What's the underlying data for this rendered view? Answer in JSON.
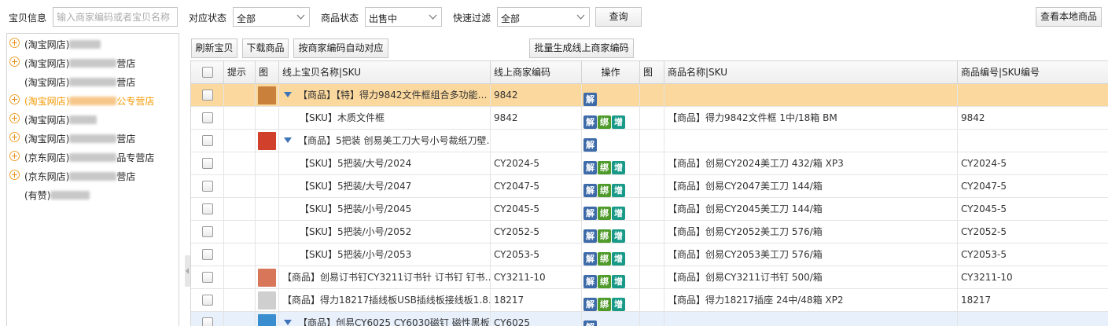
{
  "filters": {
    "item_info_label": "宝贝信息",
    "item_info_placeholder": "输入商家编码或者宝贝名称",
    "match_status_label": "对应状态",
    "match_status_value": "全部",
    "product_status_label": "商品状态",
    "product_status_value": "出售中",
    "quick_filter_label": "快速过滤",
    "quick_filter_value": "全部",
    "query_button": "查询",
    "view_local_button": "查看本地商品"
  },
  "toolbar": {
    "refresh": "刷新宝贝",
    "download": "下载商品",
    "auto_match": "按商家编码自动对应",
    "batch_generate": "批量生成线上商家编码"
  },
  "tree": [
    {
      "prefix": "(淘宝网店)",
      "suffix": "",
      "expandable": true,
      "selected": false
    },
    {
      "prefix": "(淘宝网店)",
      "suffix": "营店",
      "expandable": true,
      "selected": false
    },
    {
      "prefix": "(淘宝网店)",
      "suffix": "营店",
      "expandable": false,
      "selected": false
    },
    {
      "prefix": "(淘宝网店)",
      "suffix": "公专营店",
      "expandable": true,
      "selected": true
    },
    {
      "prefix": "(淘宝网店)",
      "suffix": "",
      "expandable": true,
      "selected": false
    },
    {
      "prefix": "(淘宝网店)",
      "suffix": "营店",
      "expandable": true,
      "selected": false
    },
    {
      "prefix": "(京东网店)",
      "suffix": "品专营店",
      "expandable": true,
      "selected": false
    },
    {
      "prefix": "(京东网店)",
      "suffix": "营店",
      "expandable": true,
      "selected": false
    },
    {
      "prefix": "(有赞)",
      "suffix": "",
      "expandable": false,
      "selected": false
    }
  ],
  "columns": {
    "hint": "提示",
    "image": "图",
    "online_name": "线上宝贝名称|SKU",
    "online_code": "线上商家编码",
    "operation": "操作",
    "image2": "图",
    "product_name": "商品名称|SKU",
    "product_code": "商品编号|SKU编号"
  },
  "ops_labels": {
    "jie": "解",
    "bang": "绑",
    "zeng": "增"
  },
  "rows": [
    {
      "type": "product",
      "name": "【商品】【特】得力9842文件框组合多功能…",
      "code": "9842",
      "ops": [
        "jie"
      ],
      "product": "",
      "pcode": "",
      "thumb": "#c9803a",
      "selected": true
    },
    {
      "type": "sku",
      "name": "【SKU】木质文件框",
      "code": "9842",
      "ops": [
        "jie",
        "bang",
        "zeng"
      ],
      "product": "【商品】得力9842文件框 1中/18箱 BM",
      "pcode": "9842"
    },
    {
      "type": "product",
      "name": "【商品】5把装 创易美工刀大号小号裁纸刀壁…",
      "code": "",
      "ops": [
        "jie"
      ],
      "product": "",
      "pcode": "",
      "thumb": "#d0402a"
    },
    {
      "type": "sku",
      "name": "【SKU】5把装/大号/2024",
      "code": "CY2024-5",
      "ops": [
        "jie",
        "bang",
        "zeng"
      ],
      "product": "【商品】创易CY2024美工刀 432/箱 XP3",
      "pcode": "CY2024-5"
    },
    {
      "type": "sku",
      "name": "【SKU】5把装/大号/2047",
      "code": "CY2047-5",
      "ops": [
        "jie",
        "bang",
        "zeng"
      ],
      "product": "【商品】创易CY2047美工刀 144/箱",
      "pcode": "CY2047-5"
    },
    {
      "type": "sku",
      "name": "【SKU】5把装/小号/2045",
      "code": "CY2045-5",
      "ops": [
        "jie",
        "bang",
        "zeng"
      ],
      "product": "【商品】创易CY2045美工刀 144/箱",
      "pcode": "CY2045-5"
    },
    {
      "type": "sku",
      "name": "【SKU】5把装/小号/2052",
      "code": "CY2052-5",
      "ops": [
        "jie",
        "bang",
        "zeng"
      ],
      "product": "【商品】创易CY2052美工刀 576/箱",
      "pcode": "CY2052-5"
    },
    {
      "type": "sku",
      "name": "【SKU】5把装/小号/2053",
      "code": "CY2053-5",
      "ops": [
        "jie",
        "bang",
        "zeng"
      ],
      "product": "【商品】创易CY2053美工刀 576/箱",
      "pcode": "CY2053-5"
    },
    {
      "type": "single",
      "name": "【商品】创易订书钉CY3211订书针 订书钉 钉书…",
      "code": "CY3211-10",
      "ops": [
        "jie",
        "bang",
        "zeng"
      ],
      "product": "【商品】创易CY3211订书钉 500/箱",
      "pcode": "CY3211-10",
      "thumb": "#d8765a"
    },
    {
      "type": "single",
      "name": "【商品】得力18217插线板USB插线板接线板1.8…",
      "code": "18217",
      "ops": [
        "jie",
        "bang",
        "zeng"
      ],
      "product": "【商品】得力18217插座 24中/48箱 XP2",
      "pcode": "18217",
      "thumb": "#cfcfcf"
    },
    {
      "type": "product",
      "name": "【商品】创易CY6025 CY6030磁钉 磁性黑板…",
      "code": "CY6025",
      "ops": [
        "jie"
      ],
      "product": "",
      "pcode": "",
      "thumb": "#3a8ed0",
      "hover": true
    }
  ]
}
